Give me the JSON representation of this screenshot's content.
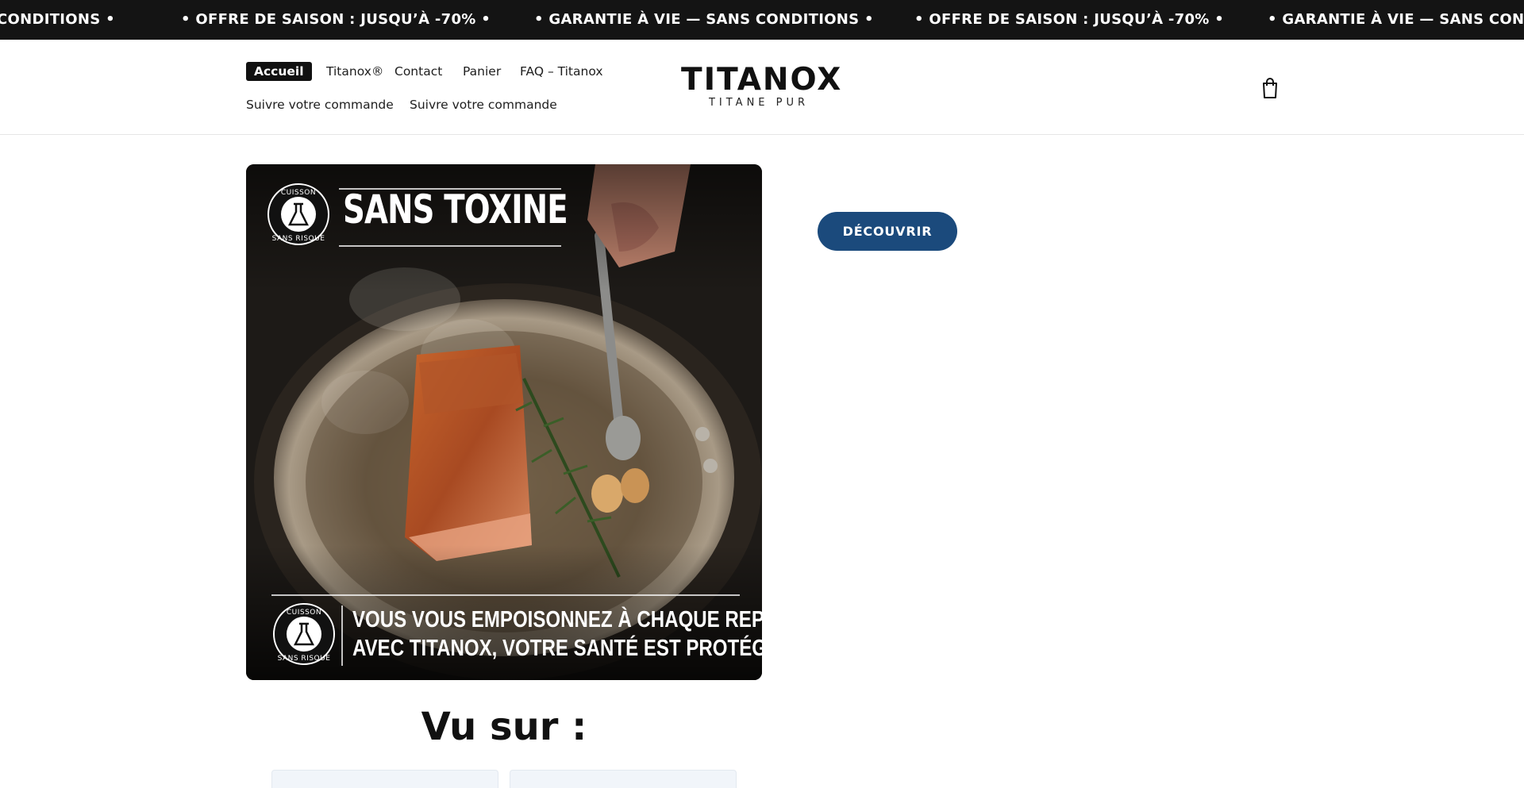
{
  "announcement": {
    "items": [
      "CONDITIONS •",
      "• OFFRE DE SAISON : JUSQU’À -70% •",
      "• GARANTIE À VIE — SANS CONDITIONS •",
      "• OFFRE DE SAISON : JUSQU’À -70% •",
      "• GARANTIE À VIE — SANS CONDITIONS •"
    ]
  },
  "nav": {
    "items": [
      {
        "label": "Accueil",
        "active": true
      },
      {
        "label": "Titanox®"
      },
      {
        "label": "Contact"
      },
      {
        "label": "Panier"
      },
      {
        "label": "FAQ – Titanox"
      },
      {
        "label": "Suivre votre commande"
      },
      {
        "label": "Suivre votre commande"
      }
    ]
  },
  "logo": {
    "name": "TITANOX",
    "tagline": "TITANE PUR"
  },
  "cart": {
    "icon": "shopping-bag-icon"
  },
  "hero": {
    "title": "SANS TOXINE",
    "badge_top": "CUISSON",
    "badge_bottom": "SANS RISQUE",
    "caption_line1": "VOUS VOUS EMPOISONNEZ À CHAQUE REPAS.",
    "caption_line2": "AVEC TITANOX, VOTRE SANTÉ EST PROTÉGÉE."
  },
  "cta": {
    "label": "DÉCOUVRIR",
    "color": "#1b4a7c"
  },
  "seen_on": {
    "title": "Vu sur :"
  }
}
